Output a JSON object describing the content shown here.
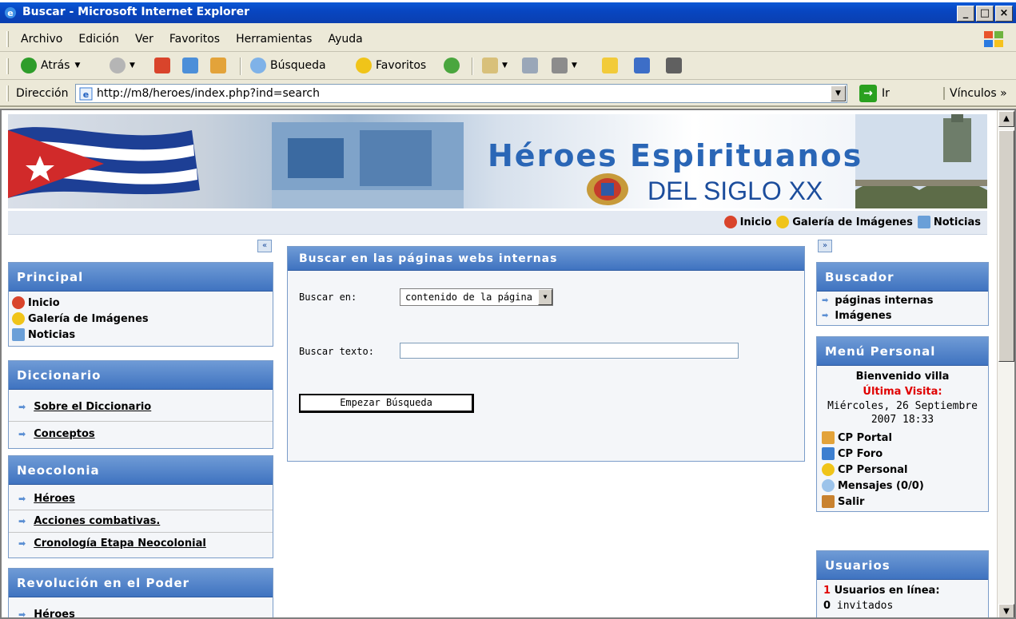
{
  "window": {
    "title": "Buscar - Microsoft Internet Explorer",
    "minimize": "_",
    "maximize": "□",
    "close": "×"
  },
  "menu": [
    "Archivo",
    "Edición",
    "Ver",
    "Favoritos",
    "Herramientas",
    "Ayuda"
  ],
  "toolbar": {
    "back": "Atrás",
    "search": "Búsqueda",
    "favorites": "Favoritos"
  },
  "address": {
    "label": "Dirección",
    "url": "http://m8/heroes/index.php?ind=search",
    "go": "Ir",
    "links": "Vínculos »"
  },
  "banner": {
    "title": "Héroes Espirituanos",
    "subtitle": "DEL SIGLO XX"
  },
  "toplinks": [
    "Inicio",
    "Galería de Imágenes",
    "Noticias"
  ],
  "collapse_left": "«",
  "collapse_right": "»",
  "principal": {
    "title": "Principal",
    "items": [
      "Inicio",
      "Galería de Imágenes",
      "Noticias"
    ]
  },
  "diccionario": {
    "title": "Diccionario",
    "items": [
      "Sobre el Diccionario",
      "Conceptos"
    ]
  },
  "neocolonia": {
    "title": "Neocolonia",
    "items": [
      "Héroes",
      "Acciones combativas.",
      "Cronología Etapa Neocolonial"
    ]
  },
  "revolucion": {
    "title": "Revolución en el Poder",
    "items": [
      "Héroes"
    ]
  },
  "search": {
    "title": "Buscar en las páginas webs internas",
    "in_label": "Buscar en:",
    "in_value": "contenido de la página",
    "text_label": "Buscar texto:",
    "text_value": "",
    "button": "Empezar Búsqueda"
  },
  "buscador": {
    "title": "Buscador",
    "items": [
      "páginas internas",
      "Imágenes"
    ]
  },
  "personal": {
    "title": "Menú Personal",
    "welcome": "Bienvenido villa",
    "last_visit_label": "Última Visita:",
    "last_visit_date": "Miércoles, 26 Septiembre 2007 18:33",
    "items": [
      "CP Portal",
      "CP Foro",
      "CP Personal",
      "Mensajes (0/0)",
      "Salir"
    ]
  },
  "usuarios": {
    "title": "Usuarios",
    "online_count": "1",
    "online_label": "Usuarios en línea:",
    "guests_count": "0",
    "guests_label": "invitados"
  },
  "colors": {
    "titlebar": "#0a4fc8",
    "panel_header": "#3f73c0",
    "accent_red": "#e00000"
  }
}
